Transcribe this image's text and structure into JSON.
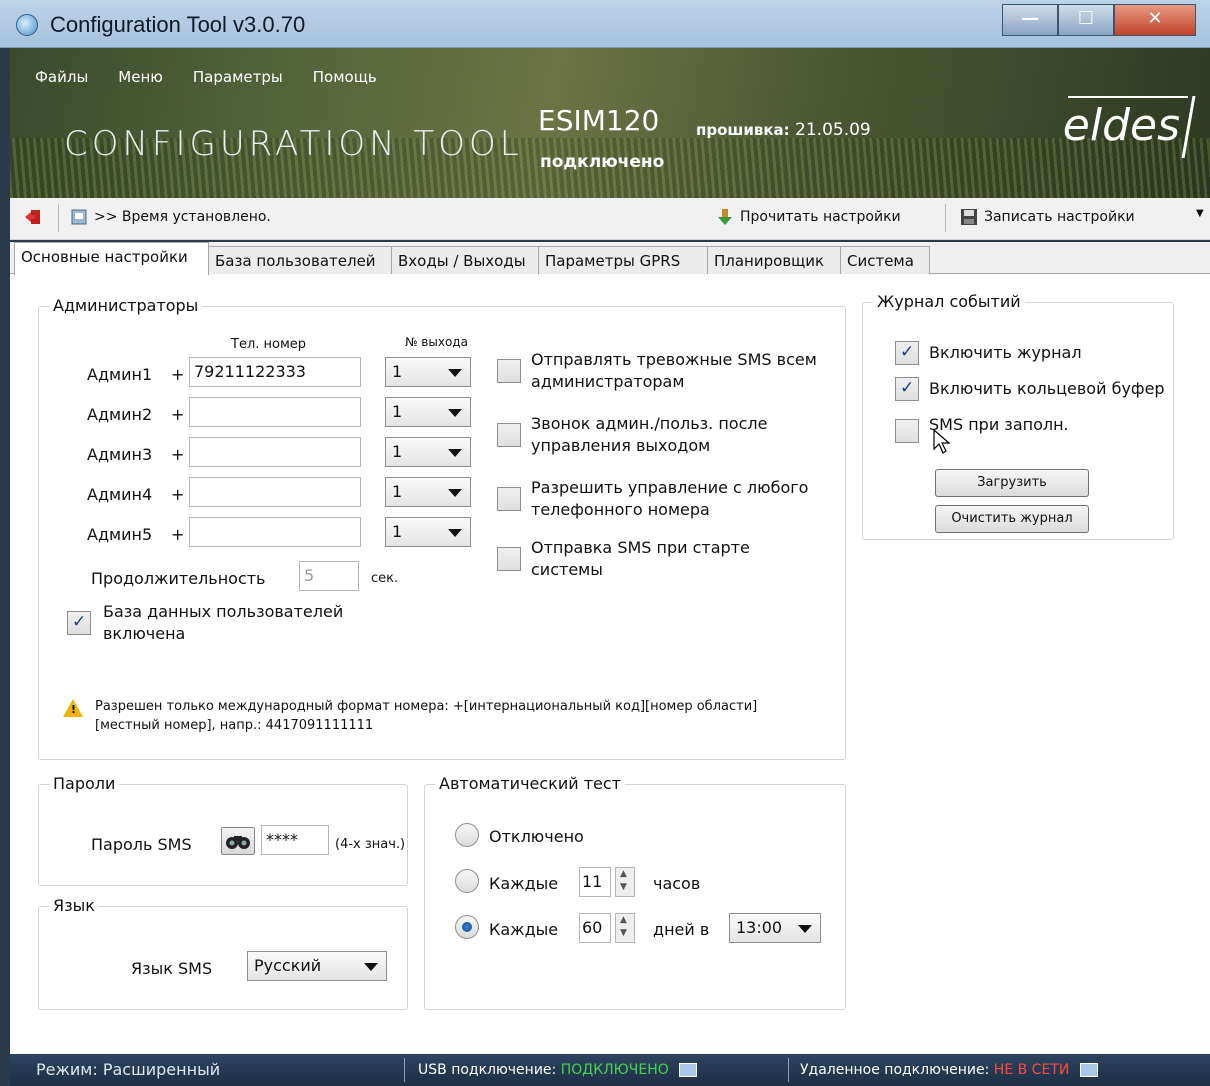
{
  "window": {
    "title": "Configuration Tool v3.0.70"
  },
  "menu": [
    "Файлы",
    "Меню",
    "Параметры",
    "Помощь"
  ],
  "banner": {
    "title": "CONFIGURATION TOOL",
    "device": "ESIM120",
    "firmware_label": "прошивка:",
    "firmware_date": "21.05.09",
    "status": "подключено",
    "logo": "eldes"
  },
  "toolbar": {
    "message": ">> Время установлено.",
    "read_label": "Прочитать настройки",
    "write_label": "Записать настройки"
  },
  "tabs": [
    "Основные настройки",
    "База пользователей",
    "Входы / Выходы",
    "Параметры GPRS",
    "Планировщик",
    "Система"
  ],
  "admins": {
    "title": "Администраторы",
    "col_phone": "Тел. номер",
    "col_output": "№ выхода",
    "plus": "+",
    "rows": [
      {
        "label": "Админ1",
        "phone": "79211122333",
        "output": "1"
      },
      {
        "label": "Админ2",
        "phone": "",
        "output": "1"
      },
      {
        "label": "Админ3",
        "phone": "",
        "output": "1"
      },
      {
        "label": "Админ4",
        "phone": "",
        "output": "1"
      },
      {
        "label": "Админ5",
        "phone": "",
        "output": "1"
      }
    ],
    "duration_label": "Продолжительность",
    "duration_value": "5",
    "duration_unit": "сек.",
    "userdb_label": "База данных пользователей включена",
    "userdb_checked": true,
    "options": [
      {
        "label": "Отправлять тревожные SMS всем администраторам",
        "checked": false
      },
      {
        "label": "Звонок админ./польз. после управления выходом",
        "checked": false
      },
      {
        "label": "Разрешить управление с любого телефонного номера",
        "checked": false
      },
      {
        "label": "Отправка SMS при старте системы",
        "checked": false
      }
    ],
    "warning": "Разрешен только международный формат номера: +[интернациональный код][номер области][местный номер], напр.: 4417091111111"
  },
  "log": {
    "title": "Журнал событий",
    "options": [
      {
        "label": "Включить журнал",
        "checked": true
      },
      {
        "label": "Включить кольцевой буфер",
        "checked": true
      },
      {
        "label": "SMS при заполн.",
        "checked": false
      }
    ],
    "load_label": "Загрузить",
    "clear_label": "Очистить журнал"
  },
  "passwords": {
    "title": "Пароли",
    "sms_label": "Пароль SMS",
    "sms_value": "****",
    "hint": "(4-х знач.)"
  },
  "language": {
    "title": "Язык",
    "sms_label": "Язык SMS",
    "value": "Русский"
  },
  "autotest": {
    "title": "Автоматический тест",
    "off_label": "Отключено",
    "every_label": "Каждые",
    "hours_value": "11",
    "hours_unit": "часов",
    "days_value": "60",
    "days_unit": "дней в",
    "time_value": "13:00",
    "selected": "days"
  },
  "statusbar": {
    "mode": "Режим: Расширенный",
    "usb_label": "USB подключение:",
    "usb_status": "ПОДКЛЮЧЕНО",
    "remote_label": "Удаленное подключение:",
    "remote_status": "НЕ В СЕТИ"
  }
}
